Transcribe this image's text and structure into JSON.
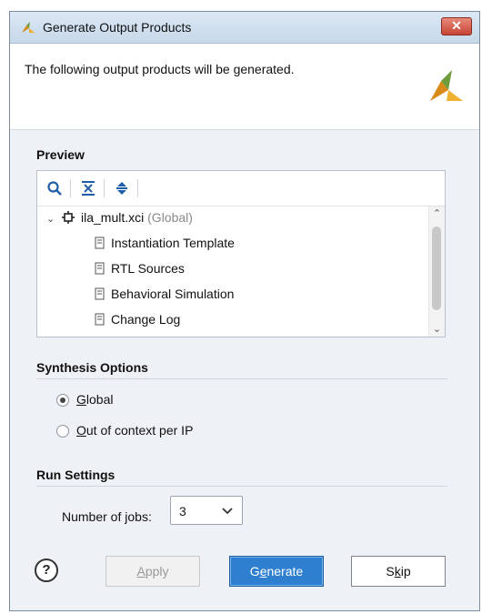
{
  "window": {
    "title": "Generate Output Products",
    "close_label": "✕"
  },
  "header": {
    "message": "The following output products will be generated."
  },
  "preview": {
    "title": "Preview",
    "tree": {
      "root_name": "ila_mult.xci",
      "root_scope": "(Global)",
      "children": [
        "Instantiation Template",
        "RTL Sources",
        "Behavioral Simulation",
        "Change Log"
      ]
    }
  },
  "synthesis": {
    "title": "Synthesis Options",
    "options": [
      {
        "prefix": "",
        "mnemonic": "G",
        "rest": "lobal",
        "selected": true
      },
      {
        "prefix": "",
        "mnemonic": "O",
        "rest": "ut of context per IP",
        "selected": false
      }
    ]
  },
  "run": {
    "title": "Run Settings",
    "jobs_label_prefix": "Number of ",
    "jobs_label_mnemonic": "j",
    "jobs_label_suffix": "obs:",
    "jobs_value": "3"
  },
  "buttons": {
    "help": "?",
    "apply": {
      "mnemonic": "A",
      "rest": "pply"
    },
    "generate": {
      "prefix": "G",
      "mnemonic": "e",
      "rest": "nerate"
    },
    "skip": {
      "prefix": "S",
      "mnemonic": "k",
      "rest": "ip"
    }
  },
  "colors": {
    "accent": "#2f7fd0",
    "logo": "#e8a020",
    "logo_shade": "#6b8e23"
  }
}
